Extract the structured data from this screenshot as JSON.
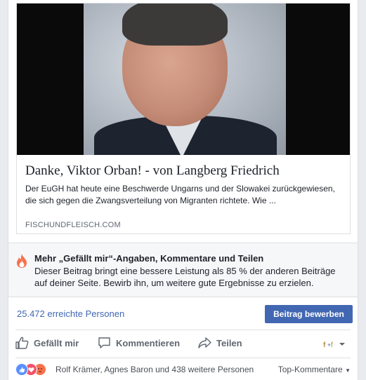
{
  "link": {
    "title": "Danke, Viktor Orban! - von Langberg Friedrich",
    "description": "Der EuGH hat heute eine Beschwerde Ungarns und der Slowakei zurückgewiesen, die sich gegen die Zwangsverteilung von Migranten richtete. Wie ...",
    "domain": "FISCHUNDFLEISCH.COM"
  },
  "boost": {
    "title": "Mehr „Gefällt mir“-Angaben, Kommentare und Teilen",
    "text": "Dieser Beitrag bringt eine bessere Leistung als 85 % der anderen Beiträge auf deiner Seite. Bewirb ihn, um weitere gute Ergebnisse zu erzielen."
  },
  "reach": {
    "label": "25.472 erreichte Personen",
    "button": "Beitrag bewerben"
  },
  "actions": {
    "like": "Gefällt mir",
    "comment": "Kommentieren",
    "share": "Teilen"
  },
  "reactions": {
    "names": "Rolf Krämer, Agnes Baron und 438 weitere Personen",
    "sort": "Top-Kommentare"
  },
  "colors": {
    "accent": "#4267b2",
    "like_blue": "#5890ff",
    "love_red": "#f25268",
    "angry_orange": "#f7714c"
  }
}
